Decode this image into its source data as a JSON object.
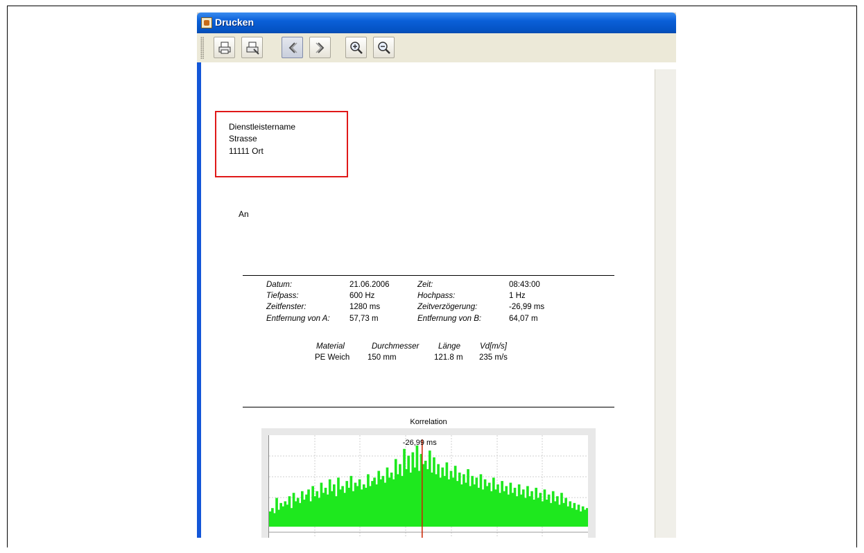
{
  "window": {
    "title": "Drucken"
  },
  "toolbar": {
    "buttons": [
      {
        "name": "print-button",
        "icon": "printer-icon"
      },
      {
        "name": "print-setup-button",
        "icon": "printer-setup-icon"
      },
      {
        "name": "previous-page-button",
        "icon": "chevron-left-icon"
      },
      {
        "name": "next-page-button",
        "icon": "chevron-right-icon"
      },
      {
        "name": "zoom-in-button",
        "icon": "zoom-in-icon"
      },
      {
        "name": "zoom-out-button",
        "icon": "zoom-out-icon"
      }
    ]
  },
  "document": {
    "sender": {
      "name": "Dienstleistername",
      "street": "Strasse",
      "city": "11111 Ort"
    },
    "recipient_label": "An",
    "measurement": {
      "labels": {
        "date": "Datum:",
        "time": "Zeit:",
        "lowpass": "Tiefpass:",
        "highpass": "Hochpass:",
        "window": "Zeitfenster:",
        "delay": "Zeitverzögerung:",
        "dist_a": "Entfernung von A:",
        "dist_b": "Entfernung von B:"
      },
      "values": {
        "date": "21.06.2006",
        "time": "08:43:00",
        "lowpass": "600 Hz",
        "highpass": "1 Hz",
        "window": "1280 ms",
        "delay": "-26,99 ms",
        "dist_a": "57,73 m",
        "dist_b": "64,07 m"
      }
    },
    "pipe": {
      "headers": [
        "Material",
        "Durchmesser",
        "Länge",
        "Vd[m/s]"
      ],
      "row": [
        "PE Weich",
        "150 mm",
        "121.8 m",
        "235 m/s"
      ]
    }
  },
  "chart_data": {
    "type": "bar",
    "title": "Korrelation",
    "annotation": "-26,99 ms",
    "marker_x_fraction": 0.48,
    "colors": {
      "bars": "#1ee81e",
      "marker": "#cc2200"
    },
    "grid": true,
    "values": [
      0.18,
      0.22,
      0.16,
      0.34,
      0.2,
      0.28,
      0.24,
      0.3,
      0.26,
      0.36,
      0.22,
      0.4,
      0.3,
      0.34,
      0.28,
      0.42,
      0.32,
      0.38,
      0.44,
      0.3,
      0.48,
      0.36,
      0.42,
      0.34,
      0.52,
      0.4,
      0.46,
      0.38,
      0.56,
      0.42,
      0.5,
      0.36,
      0.58,
      0.44,
      0.48,
      0.4,
      0.54,
      0.46,
      0.6,
      0.42,
      0.52,
      0.48,
      0.56,
      0.44,
      0.5,
      0.46,
      0.62,
      0.48,
      0.54,
      0.58,
      0.5,
      0.66,
      0.56,
      0.6,
      0.52,
      0.7,
      0.58,
      0.64,
      0.56,
      0.8,
      0.62,
      0.74,
      0.6,
      0.92,
      0.68,
      0.84,
      0.64,
      0.88,
      0.7,
      0.96,
      0.66,
      0.86,
      0.74,
      0.78,
      0.68,
      0.9,
      0.64,
      0.82,
      0.62,
      0.74,
      0.58,
      0.7,
      0.6,
      0.76,
      0.56,
      0.66,
      0.58,
      0.72,
      0.54,
      0.64,
      0.5,
      0.62,
      0.52,
      0.68,
      0.48,
      0.6,
      0.5,
      0.58,
      0.46,
      0.62,
      0.44,
      0.56,
      0.48,
      0.52,
      0.42,
      0.58,
      0.44,
      0.5,
      0.4,
      0.54,
      0.42,
      0.48,
      0.38,
      0.52,
      0.4,
      0.46,
      0.36,
      0.5,
      0.38,
      0.44,
      0.34,
      0.48,
      0.36,
      0.42,
      0.32,
      0.46,
      0.34,
      0.4,
      0.3,
      0.44,
      0.32,
      0.38,
      0.28,
      0.42,
      0.3,
      0.36,
      0.26,
      0.4,
      0.28,
      0.34,
      0.24,
      0.3,
      0.22,
      0.28,
      0.2,
      0.26,
      0.18,
      0.24,
      0.2,
      0.22
    ]
  }
}
